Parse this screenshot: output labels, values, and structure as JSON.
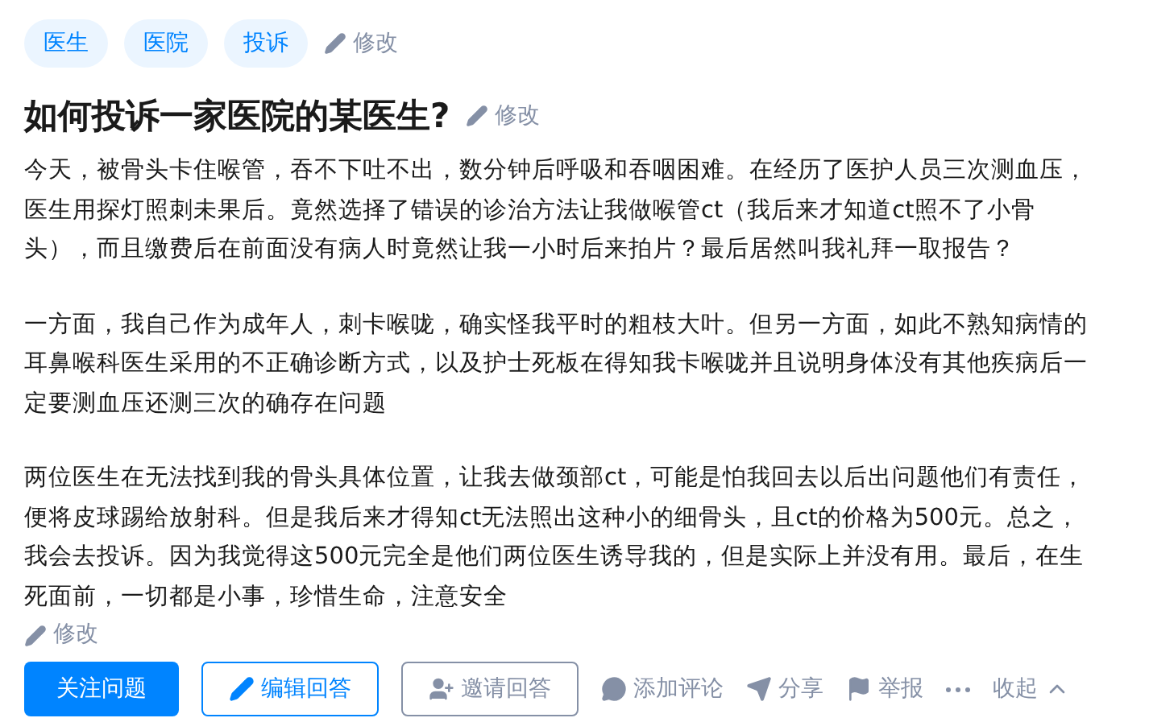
{
  "tags": [
    {
      "label": "医生"
    },
    {
      "label": "医院"
    },
    {
      "label": "投诉"
    }
  ],
  "tags_edit": "修改",
  "title": "如何投诉一家医院的某医生?",
  "title_edit": "修改",
  "paragraphs": [
    [
      "今天，被骨头卡住喉管，吞不下吐不出，数分钟后呼吸和吞咽困难。在经历了医护人员三次测血压，",
      "医生用探灯照刺未果后。竟然选择了错误的诊治方法让我做喉管ct（我后来才知道ct照不了小骨",
      "头），而且缴费后在前面没有病人时竟然让我一小时后来拍片？最后居然叫我礼拜一取报告？"
    ],
    [
      "一方面，我自己作为成年人，刺卡喉咙，确实怪我平时的粗枝大叶。但另一方面，如此不熟知病情的",
      "耳鼻喉科医生采用的不正确诊断方式，以及护士死板在得知我卡喉咙并且说明身体没有其他疾病后一",
      "定要测血压还测三次的确存在问题"
    ],
    [
      "两位医生在无法找到我的骨头具体位置，让我去做颈部ct，可能是怕我回去以后出问题他们有责任，",
      "便将皮球踢给放射科。但是我后来才得知ct无法照出这种小的细骨头，且ct的价格为500元。总之，",
      "我会去投诉。因为我觉得这500元完全是他们两位医生诱导我的，但是实际上并没有用。最后，在生",
      "死面前，一切都是小事，珍惜生命，注意安全"
    ]
  ],
  "answer_edit": "修改",
  "actions": [
    {
      "kind": "primary",
      "label": "关注问题"
    },
    {
      "kind": "outline-blue",
      "label": "编辑回答"
    },
    {
      "kind": "outline-gray",
      "label": "邀请回答"
    },
    {
      "kind": "comment",
      "label": "添加评论"
    },
    {
      "kind": "share",
      "label": "分享"
    },
    {
      "kind": "report",
      "label": "举报"
    },
    {
      "kind": "more"
    },
    {
      "kind": "collapse",
      "label": "收起"
    }
  ]
}
